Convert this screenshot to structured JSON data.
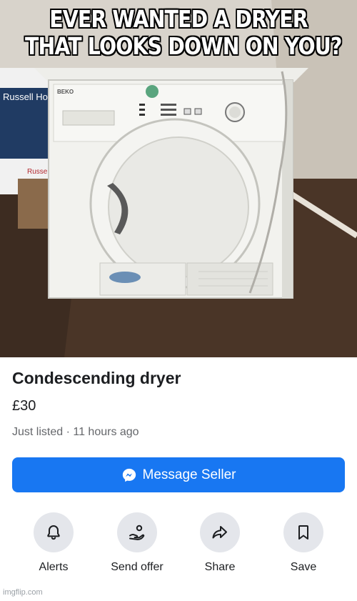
{
  "meme": {
    "caption_line1": "EVER WANTED A DRYER",
    "caption_line2": "THAT LOOKS DOWN ON YOU?"
  },
  "photo": {
    "box_brand_top": "Russell Ho",
    "box_brand_bottom": "Russell Ho",
    "dryer_brand": "BEKO"
  },
  "listing": {
    "title": "Condescending dryer",
    "price": "£30",
    "meta": "Just listed · 11 hours ago"
  },
  "message_button": {
    "label": "Message Seller",
    "icon": "messenger-icon",
    "color": "#1877f2"
  },
  "actions": [
    {
      "label": "Alerts",
      "icon": "bell-icon"
    },
    {
      "label": "Send offer",
      "icon": "offer-hand-icon"
    },
    {
      "label": "Share",
      "icon": "share-arrow-icon"
    },
    {
      "label": "Save",
      "icon": "bookmark-icon"
    }
  ],
  "watermark": "imgflip.com"
}
